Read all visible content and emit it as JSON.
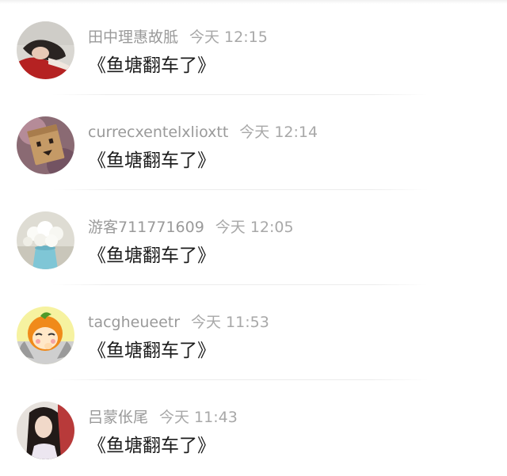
{
  "comments": [
    {
      "username": "田中理惠故胝",
      "time": "今天 12:15",
      "content": "《鱼塘翻车了》",
      "avatar_icon": "user-avatar-photo"
    },
    {
      "username": "currecxentelxlioxtt",
      "time": "今天 12:14",
      "content": "《鱼塘翻车了》",
      "avatar_icon": "user-avatar-box-doll"
    },
    {
      "username": "游客711771609",
      "time": "今天 12:05",
      "content": "《鱼塘翻车了》",
      "avatar_icon": "user-avatar-flowers"
    },
    {
      "username": "tacgheueetr",
      "time": "今天 11:53",
      "content": "《鱼塘翻车了》",
      "avatar_icon": "user-avatar-orange-cartoon"
    },
    {
      "username": "吕蒙伥尾",
      "time": "今天 11:43",
      "content": "《鱼塘翻车了》",
      "avatar_icon": "user-avatar-photo"
    }
  ]
}
